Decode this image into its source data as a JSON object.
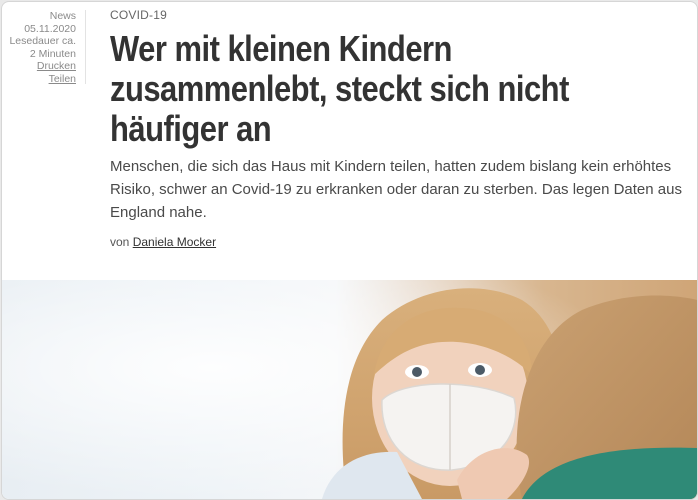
{
  "meta": {
    "category": "News",
    "date": "05.11.2020",
    "reading_time": "Lesedauer ca. 2 Minuten",
    "print_label": "Drucken",
    "share_label": "Teilen"
  },
  "article": {
    "kicker": "COVID-19",
    "headline": "Wer mit kleinen Kindern zusammenlebt, steckt sich nicht häufiger an",
    "lead": "Menschen, die sich das Haus mit Kindern teilen, hatten zudem bislang kein erhöhtes Risiko, schwer an Covid-19 zu erkranken oder daran zu sterben. Das legen Daten aus England nahe.",
    "author_prefix": "von",
    "author_name": "Daniela Mocker"
  },
  "hero_image": {
    "subject": "child-with-face-mask-hugging-adult"
  },
  "colors": {
    "headline": "#333333",
    "meta_text": "#8a8a8a",
    "background": "#ffffff"
  }
}
